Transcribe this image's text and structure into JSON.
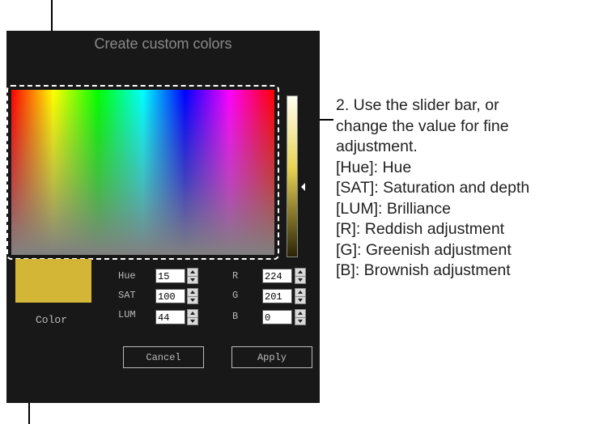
{
  "dialog": {
    "title": "Create custom colors",
    "color_label": "Color",
    "swatch_color": "#d4b637",
    "cancel_label": "Cancel",
    "apply_label": "Apply"
  },
  "fields": {
    "hue": {
      "label": "Hue",
      "value": "15"
    },
    "sat": {
      "label": "SAT",
      "value": "100"
    },
    "lum": {
      "label": "LUM",
      "value": "44"
    },
    "r": {
      "label": "R",
      "value": "224"
    },
    "g": {
      "label": "G",
      "value": "201"
    },
    "b": {
      "label": "B",
      "value": "0"
    }
  },
  "annotation": {
    "lines": [
      "2. Use the slider bar, or",
      "change the value for fine",
      "adjustment.",
      "[Hue]: Hue",
      "[SAT]: Saturation and depth",
      "[LUM]: Brilliance",
      "[R]: Reddish adjustment",
      "[G]: Greenish adjustment",
      "[B]: Brownish adjustment"
    ]
  }
}
